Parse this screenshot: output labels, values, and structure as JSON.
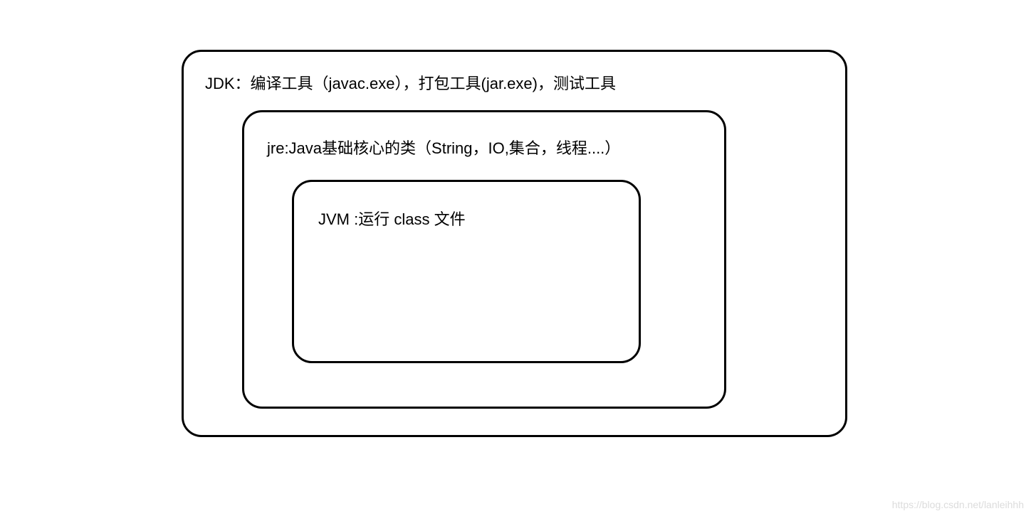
{
  "diagram": {
    "jdk": {
      "label": "JDK：编译工具（javac.exe），打包工具(jar.exe)，测试工具"
    },
    "jre": {
      "label": "jre:Java基础核心的类（String，IO,集合，线程....）"
    },
    "jvm": {
      "label": "JVM :运行 class 文件"
    }
  },
  "watermark": "https://blog.csdn.net/lanleihhh"
}
